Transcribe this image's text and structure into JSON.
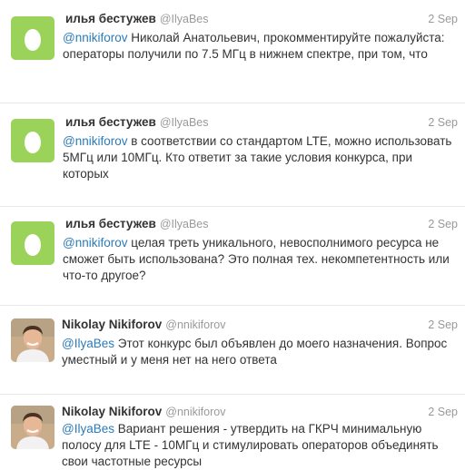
{
  "tweets": [
    {
      "name": "илья бестужев",
      "handle": "@IlyaBes",
      "time": "2 Sep",
      "avatar_icon": "egg-avatar-icon",
      "mention": "@nnikiforov",
      "text": " Николай Анатольевич, прокомментируйте пожалуйста: операторы получили по 7.5 МГц в нижнем спектре, при том, что"
    },
    {
      "name": "илья бестужев",
      "handle": "@IlyaBes",
      "time": "2 Sep",
      "avatar_icon": "egg-avatar-icon",
      "mention": "@nnikiforov",
      "text": " в соответствии со стандартом LTE, можно использовать 5МГц или 10МГц. Кто ответит за такие условия конкурса, при которых"
    },
    {
      "name": "илья бестужев",
      "handle": "@IlyaBes",
      "time": "2 Sep",
      "avatar_icon": "egg-avatar-icon",
      "mention": "@nnikiforov",
      "text": " целая треть уникального, невосполнимого ресурса не сможет быть использована? Это полная тех. некомпетентность или что-то другое?"
    },
    {
      "name": "Nikolay Nikiforov",
      "handle": "@nnikiforov",
      "time": "2 Sep",
      "avatar_icon": "user-photo-icon",
      "mention": "@IlyaBes",
      "text": " Этот конкурс был объявлен до моего назначения. Вопрос уместный и у меня нет на него ответа"
    },
    {
      "name": "Nikolay Nikiforov",
      "handle": "@nnikiforov",
      "time": "2 Sep",
      "avatar_icon": "user-photo-icon",
      "mention": "@IlyaBes",
      "text": " Вариант решения - утвердить на ГКРЧ минимальную полосу для LTE - 10МГц и стимулировать операторов объединять свои частотные ресурсы"
    }
  ],
  "colors": {
    "egg_background": "#9bd35a",
    "link": "#2b7bb9",
    "meta_text": "#999999",
    "body_text": "#333333",
    "divider": "#e8e8e8"
  }
}
